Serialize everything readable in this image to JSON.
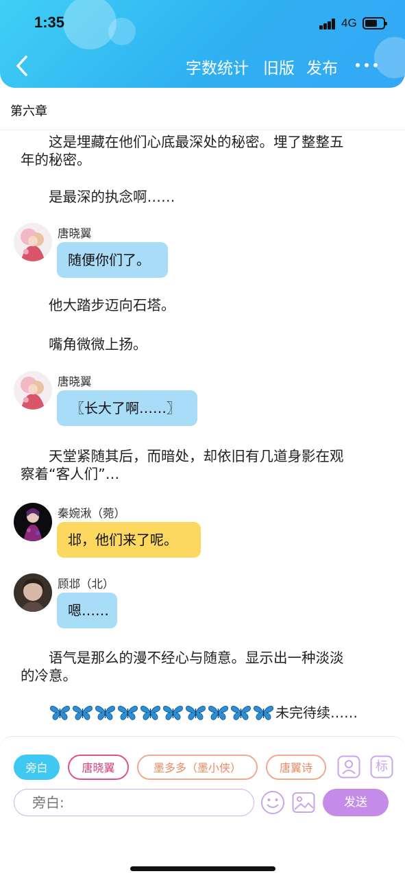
{
  "status_bar": {
    "time": "1:35",
    "network": "4G"
  },
  "nav": {
    "word_count": "字数统计",
    "old_version": "旧版",
    "publish": "发布"
  },
  "chapter": {
    "title": "第六章"
  },
  "content": {
    "p1_line1": "这是埋藏在他们心底最深处的秘密。埋了整整五",
    "p1_line2": "年的秘密。",
    "p2": "是最深的执念啊……",
    "dialog1": {
      "name": "唐晓翼",
      "text": "随便你们了。"
    },
    "p3": "他大踏步迈向石塔。",
    "p4": "嘴角微微上扬。",
    "dialog2": {
      "name": "唐晓翼",
      "text": "〖长大了啊……〗"
    },
    "p5_line1": "天堂紧随其后，而暗处，却依旧有几道身影在观",
    "p5_line2": "察着“客人们”…",
    "dialog3": {
      "name": "秦婉湫（菀）",
      "text": "邶，他们来了呢。"
    },
    "dialog4": {
      "name": "顾邶（北）",
      "text": "嗯……"
    },
    "p6_line1": "语气是那么的漫不经心与随意。显示出一种淡淡",
    "p6_line2": "的冷意。",
    "ending_icon": "butterfly-icon",
    "ending_icon_count": 10,
    "ending_text": "未完待续……"
  },
  "bottom": {
    "roles": [
      "旁白",
      "唐晓翼",
      "墨多多（墨小侠）",
      "唐翼诗"
    ],
    "mark_label": "标",
    "input_placeholder": "旁白:",
    "send_label": "发送"
  },
  "colors": {
    "header_start": "#3fd0f4",
    "header_end": "#35a8f5",
    "bubble_blue": "#a8dcf7",
    "bubble_yellow": "#fcd861",
    "active_chip": "#3fc9f2",
    "send_button": "#c48be8"
  }
}
